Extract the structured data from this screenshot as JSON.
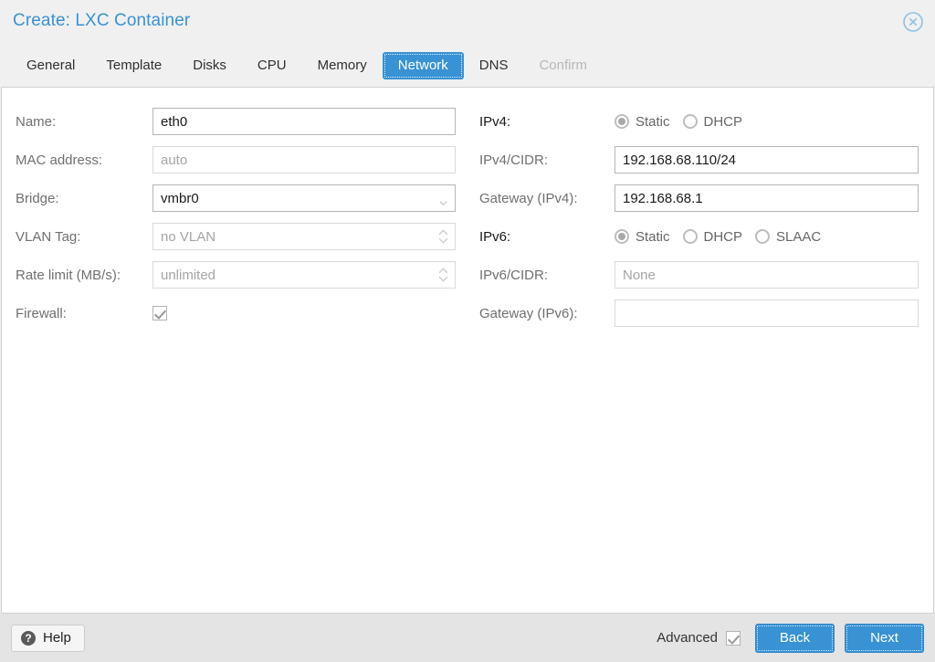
{
  "window": {
    "title": "Create: LXC Container",
    "close_icon": "close-circle-icon"
  },
  "tabs": [
    {
      "label": "General",
      "state": "normal"
    },
    {
      "label": "Template",
      "state": "normal"
    },
    {
      "label": "Disks",
      "state": "normal"
    },
    {
      "label": "CPU",
      "state": "normal"
    },
    {
      "label": "Memory",
      "state": "normal"
    },
    {
      "label": "Network",
      "state": "active"
    },
    {
      "label": "DNS",
      "state": "normal"
    },
    {
      "label": "Confirm",
      "state": "disabled"
    }
  ],
  "left_form": {
    "name": {
      "label": "Name:",
      "value": "eth0",
      "placeholder": ""
    },
    "mac": {
      "label": "MAC address:",
      "value": "",
      "placeholder": "auto"
    },
    "bridge": {
      "label": "Bridge:",
      "value": "vmbr0",
      "icon": "chevron-down-icon"
    },
    "vlan": {
      "label": "VLAN Tag:",
      "value": "",
      "placeholder": "no VLAN",
      "icon": "spinner-icon"
    },
    "rate": {
      "label": "Rate limit (MB/s):",
      "value": "",
      "placeholder": "unlimited",
      "icon": "spinner-icon"
    },
    "firewall": {
      "label": "Firewall:",
      "checked": true
    }
  },
  "right_form": {
    "ipv4": {
      "label": "IPv4:",
      "selected": "Static",
      "options": [
        "Static",
        "DHCP"
      ]
    },
    "ipv4_cidr": {
      "label": "IPv4/CIDR:",
      "value": "192.168.68.110/24",
      "placeholder": ""
    },
    "ipv4_gateway": {
      "label": "Gateway (IPv4):",
      "value": "192.168.68.1",
      "placeholder": ""
    },
    "ipv6": {
      "label": "IPv6:",
      "selected": "Static",
      "options": [
        "Static",
        "DHCP",
        "SLAAC"
      ]
    },
    "ipv6_cidr": {
      "label": "IPv6/CIDR:",
      "value": "",
      "placeholder": "None"
    },
    "ipv6_gateway": {
      "label": "Gateway (IPv6):",
      "value": "",
      "placeholder": ""
    }
  },
  "footer": {
    "help_label": "Help",
    "help_icon": "question-mark-icon",
    "advanced_label": "Advanced",
    "advanced_checked": true,
    "back_label": "Back",
    "next_label": "Next"
  },
  "colors": {
    "accent": "#3892d4",
    "title": "#3892d4",
    "panel_bg": "#ffffff",
    "chrome_bg": "#f0f0f0",
    "footer_bg": "#e4e4e4",
    "label": "#707070",
    "disabled_tab": "#b8b8b8"
  }
}
